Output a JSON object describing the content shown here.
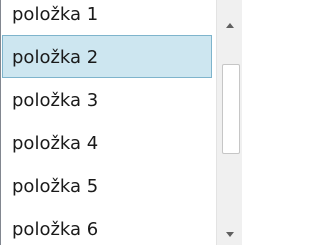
{
  "listbox": {
    "items": [
      {
        "label": "položka 1"
      },
      {
        "label": "položka 2"
      },
      {
        "label": "položka 3"
      },
      {
        "label": "položka 4"
      },
      {
        "label": "položka 5"
      },
      {
        "label": "položka 6"
      }
    ],
    "selected_label": "položka 2"
  },
  "scrollbar": {
    "up_icon": "arrow-up-icon",
    "down_icon": "arrow-down-icon"
  },
  "colors": {
    "selection_fill": "#cde6f0",
    "selection_border": "#7eb4cc",
    "text": "#1a1a1a"
  }
}
